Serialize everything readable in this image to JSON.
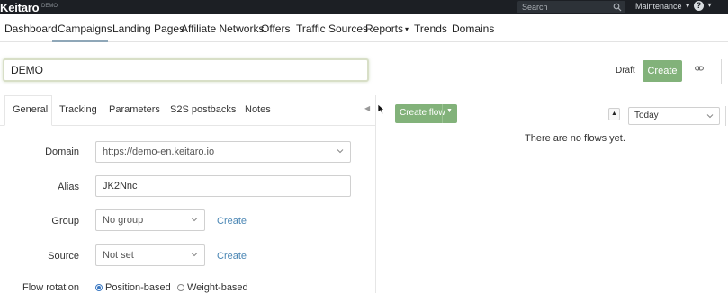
{
  "app": {
    "logo": "Keitaro",
    "logo_sub": "DEMO"
  },
  "topbar": {
    "search_placeholder": "Search",
    "maintenance_label": "Maintenance",
    "help_label": "?"
  },
  "nav": {
    "items": [
      {
        "label": "Dashboard"
      },
      {
        "label": "Campaigns"
      },
      {
        "label": "Landing Pages"
      },
      {
        "label": "Affiliate Networks"
      },
      {
        "label": "Offers"
      },
      {
        "label": "Traffic Sources"
      },
      {
        "label": "Reports"
      },
      {
        "label": "Trends"
      },
      {
        "label": "Domains"
      }
    ],
    "active": "Campaigns"
  },
  "campaign": {
    "name": "DEMO",
    "status": "Draft",
    "create_label": "Create"
  },
  "tabs": {
    "items": [
      {
        "label": "General"
      },
      {
        "label": "Tracking"
      },
      {
        "label": "Parameters"
      },
      {
        "label": "S2S postbacks"
      },
      {
        "label": "Notes"
      }
    ],
    "active": "General"
  },
  "form": {
    "domain_label": "Domain",
    "domain_value": "https://demo-en.keitaro.io",
    "alias_label": "Alias",
    "alias_value": "JK2Nnc",
    "group_label": "Group",
    "group_value": "No group",
    "group_create": "Create",
    "source_label": "Source",
    "source_value": "Not set",
    "source_create": "Create",
    "rotation_label": "Flow rotation",
    "rotation_options": [
      {
        "label": "Position-based",
        "selected": true
      },
      {
        "label": "Weight-based",
        "selected": false
      }
    ]
  },
  "flows": {
    "create_flow_label": "Create flow",
    "date_range": "Today",
    "empty_message": "There are no flows yet."
  },
  "colors": {
    "topbar_bg": "#1c1f24",
    "primary_green": "#82b27a",
    "link_blue": "#4a86b4"
  }
}
